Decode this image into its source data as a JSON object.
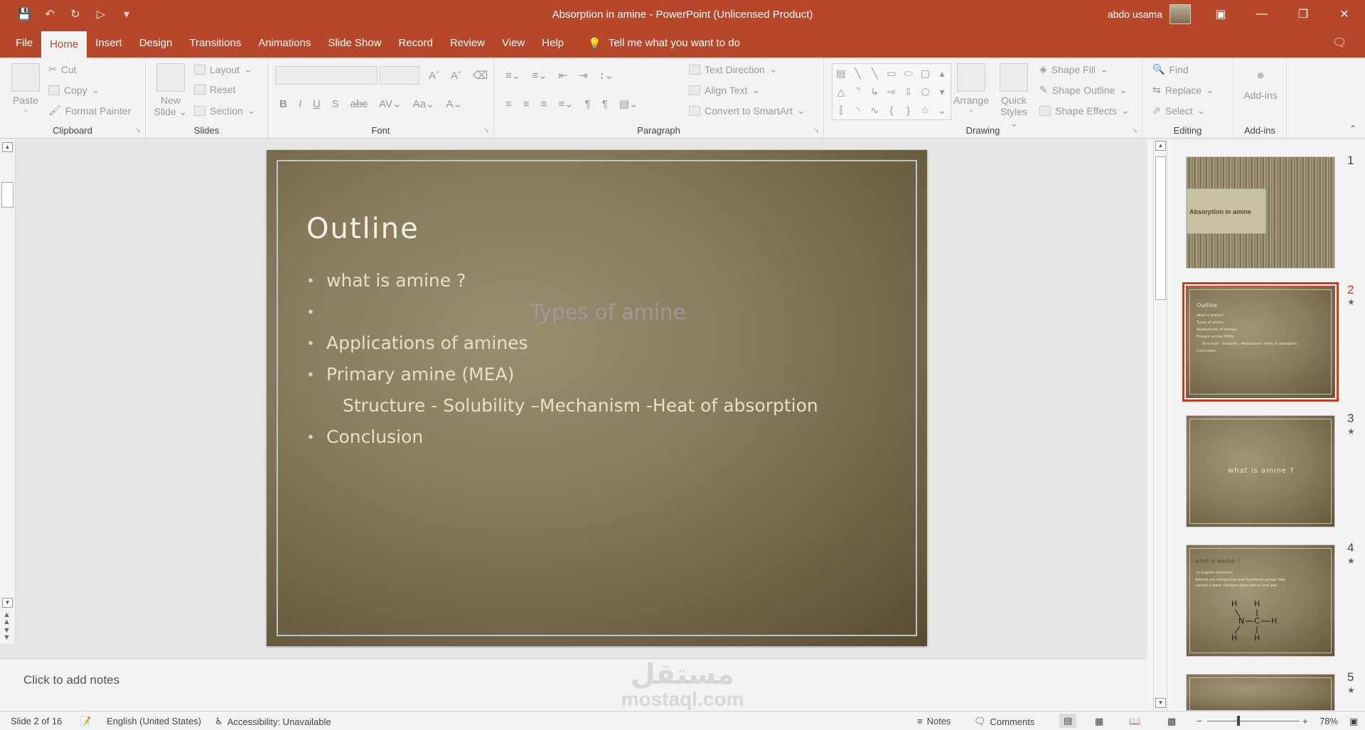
{
  "titlebar": {
    "title": "Absorption in amine  -  PowerPoint (Unlicensed Product)",
    "user": "abdo usama",
    "qat": [
      "save-icon",
      "undo-icon",
      "redo-icon",
      "start-from-beginning-icon",
      "customize-icon"
    ],
    "window_buttons": [
      "ribbon-display-icon",
      "minimize-icon",
      "restore-icon",
      "close-icon"
    ]
  },
  "tabs": [
    "File",
    "Home",
    "Insert",
    "Design",
    "Transitions",
    "Animations",
    "Slide Show",
    "Record",
    "Review",
    "View",
    "Help"
  ],
  "active_tab": "Home",
  "tell_me": "Tell me what you want to do",
  "ribbon": {
    "clipboard": {
      "label": "Clipboard",
      "paste": "Paste",
      "cut": "Cut",
      "copy": "Copy",
      "format_painter": "Format Painter"
    },
    "slides": {
      "label": "Slides",
      "new_slide_1": "New",
      "new_slide_2": "Slide",
      "layout": "Layout",
      "reset": "Reset",
      "section": "Section"
    },
    "font": {
      "label": "Font"
    },
    "paragraph": {
      "label": "Paragraph",
      "text_direction": "Text Direction",
      "align_text": "Align Text",
      "convert_smartart": "Convert to SmartArt"
    },
    "drawing": {
      "label": "Drawing",
      "arrange": "Arrange",
      "quick_styles_1": "Quick",
      "quick_styles_2": "Styles",
      "shape_fill": "Shape Fill",
      "shape_outline": "Shape Outline",
      "shape_effects": "Shape Effects"
    },
    "editing": {
      "label": "Editing",
      "find": "Find",
      "replace": "Replace",
      "select": "Select"
    },
    "addins": {
      "label": "Add-ins",
      "button": "Add-ins"
    }
  },
  "slide": {
    "title": "Outline",
    "bullets": [
      {
        "text": "what is amine ?",
        "size": "normal"
      },
      {
        "text": "Types of amine",
        "size": "large"
      },
      {
        "text": "Applications of amines",
        "size": "normal"
      },
      {
        "text": "Primary amine (MEA)",
        "size": "normal"
      },
      {
        "text": "Structure  - Solubility –Mechanism -Heat of absorption",
        "size": "sub"
      },
      {
        "text": "Conclusion",
        "size": "normal"
      }
    ]
  },
  "notes": {
    "placeholder": "Click to add notes",
    "watermark_ar": "مستقل",
    "watermark_en": "mostaql.com"
  },
  "thumbnails": [
    {
      "number": "1",
      "title": "Absorption in amine"
    },
    {
      "number": "2",
      "star": "★",
      "title": "Outline",
      "lines": [
        "what is amine ?",
        "Types of amine",
        "Applications of amines",
        "Primary amine (MEA)",
        "Structure  - Solubility –Mechanism -Heat of absorption",
        "Conclusion"
      ]
    },
    {
      "number": "3",
      "star": "★",
      "title": "what is amine ?"
    },
    {
      "number": "4",
      "star": "★",
      "title": "what is amine ?",
      "lines": [
        "In organic chemistry",
        "Amines  are  compounds and functional groups that",
        "contain a basic nitrogen atom with a lone pair"
      ],
      "structure": [
        "H",
        "H",
        "N",
        "C",
        "H",
        "H",
        "H"
      ]
    },
    {
      "number": "5",
      "star": "★"
    }
  ],
  "statusbar": {
    "slide_of": "Slide 2 of 16",
    "language": "English (United States)",
    "accessibility": "Accessibility: Unavailable",
    "notes": "Notes",
    "comments": "Comments",
    "zoom": "78%",
    "zoom_fraction": 0.34
  },
  "colors": {
    "accent": "#b7472a",
    "selection": "#c43e1c"
  }
}
